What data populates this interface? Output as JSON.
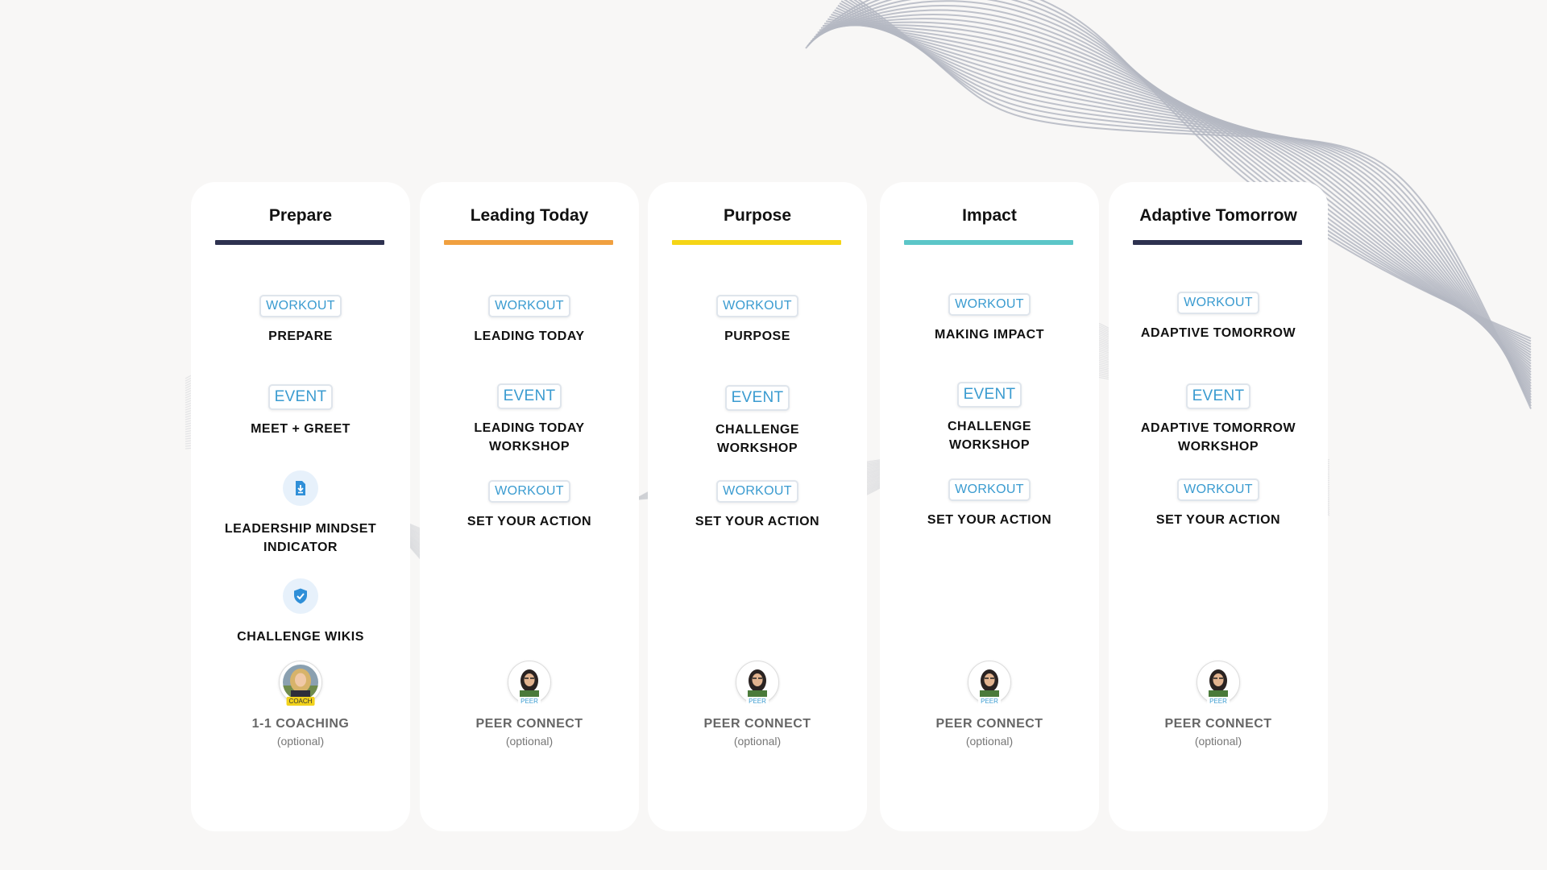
{
  "colors": {
    "background": "#f8f7f6",
    "tag_text": "#3a9bd0",
    "navy": "#2e3250",
    "orange": "#f0a040",
    "yellow": "#f5d516",
    "teal": "#5cc6c8"
  },
  "columns": [
    {
      "title": "Prepare",
      "line_color": "#2e3250",
      "items": [
        {
          "tag": "WORKOUT",
          "label": "PREPARE"
        },
        {
          "tag": "EVENT",
          "label": "MEET + GREET"
        },
        {
          "icon": "document-download-icon",
          "label": "LEADERSHIP MINDSET INDICATOR"
        },
        {
          "icon": "shield-check-icon",
          "label": "CHALLENGE WIKIS"
        },
        {
          "avatar": "coach-avatar",
          "badge": "COACH",
          "label": "1-1 COACHING",
          "sub": "(optional)"
        }
      ]
    },
    {
      "title": "Leading Today",
      "line_color": "#f0a040",
      "items": [
        {
          "tag": "WORKOUT",
          "label": "LEADING TODAY"
        },
        {
          "tag": "EVENT",
          "label": "LEADING TODAY WORKSHOP"
        },
        {
          "tag": "WORKOUT",
          "label": "SET YOUR ACTION"
        },
        {
          "avatar": "peer-avatar",
          "badge": "PEER",
          "label": "PEER CONNECT",
          "sub": "(optional)"
        }
      ]
    },
    {
      "title": "Purpose",
      "line_color": "#f5d516",
      "items": [
        {
          "tag": "WORKOUT",
          "label": "PURPOSE"
        },
        {
          "tag": "EVENT",
          "label": "CHALLENGE WORKSHOP"
        },
        {
          "tag": "WORKOUT",
          "label": "SET YOUR ACTION"
        },
        {
          "avatar": "peer-avatar",
          "badge": "PEER",
          "label": "PEER CONNECT",
          "sub": "(optional)"
        }
      ]
    },
    {
      "title": "Impact",
      "line_color": "#5cc6c8",
      "items": [
        {
          "tag": "WORKOUT",
          "label": "MAKING IMPACT"
        },
        {
          "tag": "EVENT",
          "label": "CHALLENGE WORKSHOP"
        },
        {
          "tag": "WORKOUT",
          "label": "SET YOUR ACTION"
        },
        {
          "avatar": "peer-avatar",
          "badge": "PEER",
          "label": "PEER CONNECT",
          "sub": "(optional)"
        }
      ]
    },
    {
      "title": "Adaptive Tomorrow",
      "line_color": "#2e3250",
      "items": [
        {
          "tag": "WORKOUT",
          "label": "ADAPTIVE TOMORROW"
        },
        {
          "tag": "EVENT",
          "label": "ADAPTIVE TOMORROW WORKSHOP"
        },
        {
          "tag": "WORKOUT",
          "label": "SET YOUR ACTION"
        },
        {
          "avatar": "peer-avatar",
          "badge": "PEER",
          "label": "PEER CONNECT",
          "sub": "(optional)"
        }
      ]
    }
  ]
}
